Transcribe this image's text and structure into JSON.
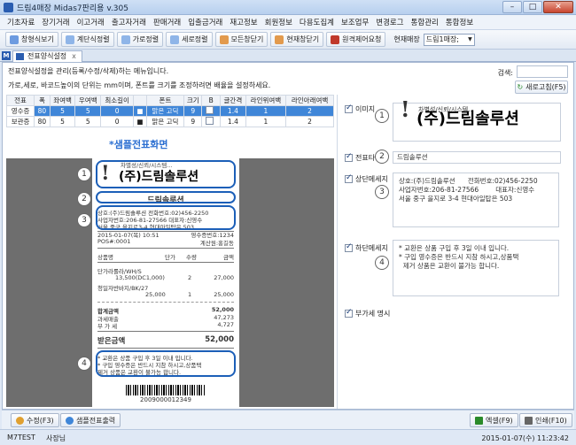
{
  "window": {
    "title": "드림4매장 Midas7판리용 v.305"
  },
  "menu": [
    "기초자료",
    "장기거래",
    "이고거래",
    "출고자거래",
    "판매거래",
    "입출금거래",
    "재고정보",
    "회원정보",
    "다용도집계",
    "보조업무",
    "변경로그",
    "통합관리",
    "통합정보"
  ],
  "toolbar": {
    "buttons": [
      "창형식보기",
      "계단식정렬",
      "가로정렬",
      "세로정렬",
      "모든창닫기",
      "현재창닫기",
      "원격제어요청"
    ],
    "store_label": "현재매장",
    "store_value": "드림1매장;"
  },
  "tab": {
    "label": "전표양식설정",
    "badge": "M",
    "close": "x"
  },
  "desc": {
    "line1": "전표양식설정을 관리(등록/수정/삭제)하는 메뉴입니다.",
    "line2": "가로,세로, 바코드높이의 단위는 mm이며, 폰트를 크기를 조정하려면 배율을 설정하세요."
  },
  "search": {
    "label": "검색:",
    "refresh": "새로고침(F5)"
  },
  "grid": {
    "headers": [
      "전표",
      "폭",
      "좌여백",
      "우여백",
      "최소길이",
      "",
      "폰트",
      "크기",
      "B",
      "글간격",
      "라인위여백",
      "라인아래여백"
    ],
    "rows": [
      [
        "영수증",
        "80",
        "5",
        "5",
        "0",
        "",
        "맑은 고딕",
        "9",
        "",
        "1.4",
        "1",
        "2"
      ],
      [
        "보관증",
        "80",
        "5",
        "5",
        "0",
        "",
        "맑은 고딕",
        "9",
        "",
        "1.4",
        "1",
        "2"
      ]
    ]
  },
  "sample": {
    "title": "*샘플전표화면",
    "logo_small": "차별성/신뢰/시스템...",
    "logo_big": "(주)드림솔루션",
    "shop_name": "드림솔루션",
    "info1": "상호:(주)드림솔루션      전화번호:02)456-2250",
    "info2": "사업자번호:206-81-27566        대표자:신영수",
    "info3": "서울 중구 을지로3-4 현대아일탑은 503",
    "date": "2015-01-07(목) 10:51",
    "receipt_no": "영수증번호:1234",
    "pos": "POS#:0001",
    "cashier": "계산원:홍길동",
    "col_item": "상품명",
    "col_price": "단가",
    "col_qty": "수량",
    "col_amt": "금액",
    "item1_name": "단가라롤라/WH/S",
    "item1_price": "13,500(DC1,000)",
    "item1_qty": "2",
    "item1_amt": "27,000",
    "item2_name": "청일자반바지/BK/27",
    "item2_price": "25,000",
    "item2_qty": "1",
    "item2_amt": "25,000",
    "total_label": "합계금액",
    "total": "52,000",
    "taxable_label": "과세매출",
    "taxable": "47,273",
    "vat_label": "부 가 세",
    "vat": "4,727",
    "received_label": "받은금액",
    "received": "52,000",
    "footer1": "* 교환은 상품 구입 후 3일 이내 입니다.",
    "footer2": "* 구입 영수증은 반드시 지참 하시고,상품택",
    "footer3": "  제거 상품은 교환이 불가능 합니다.",
    "barcode_num": "2009000012349"
  },
  "callouts": [
    "1",
    "2",
    "3",
    "4"
  ],
  "right_panel": {
    "image_label": "이미지",
    "name_label": "전표타이틀",
    "name_value": "드림솔루션",
    "header_label": "상단메세지",
    "header_value": "상호:(주)드림솔루션      전화번호:02)456-2250\n사업자번호:206-81-27566        대표자:신영수\n서울 중구 을지로 3-4 현대아일탑은 503",
    "footer_label": "하단메세지",
    "footer_value": "* 교환은 상품 구입 후 3일 이내 입니다.\n* 구입 영수증은 반드시 지참 하시고,상품택\n  제거 상품은 교환이 불가능 합니다.",
    "vat_label": "부가세 명시"
  },
  "bottom": {
    "edit": "수정(F3)",
    "sample": "샘플전표출력",
    "excel": "엑셀(F9)",
    "print": "인쇄(F10)"
  },
  "status": {
    "s1": "M7TEST",
    "s2": "사장님",
    "s3": "2015-01-07(수) 11:23:42"
  }
}
